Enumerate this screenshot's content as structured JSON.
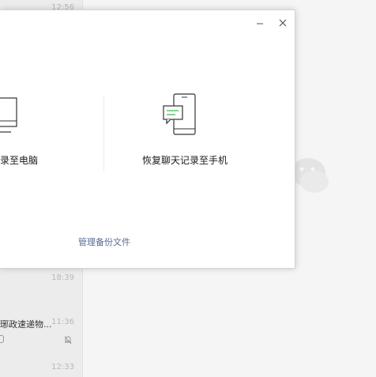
{
  "chat_list": {
    "items": [
      {
        "time": "12:56"
      },
      {
        "time": "18:39"
      },
      {
        "name": "琊政速递物...",
        "time": "11:36"
      },
      {
        "time": "12:33"
      }
    ]
  },
  "dialog": {
    "minimize_label": "−",
    "close_label": "✕",
    "backup_to_pc_label": "录至电脑",
    "restore_to_phone_label": "恢复聊天记录至手机",
    "manage_backup_label": "管理备份文件"
  },
  "icons": {
    "monitor": "monitor-icon",
    "phone": "phone-chat-icon",
    "logo": "wechat-logo-icon",
    "mute": "mute-bell-icon"
  },
  "colors": {
    "link": "#576b95",
    "background": "#f5f5f5",
    "sidebar": "#ececec"
  }
}
